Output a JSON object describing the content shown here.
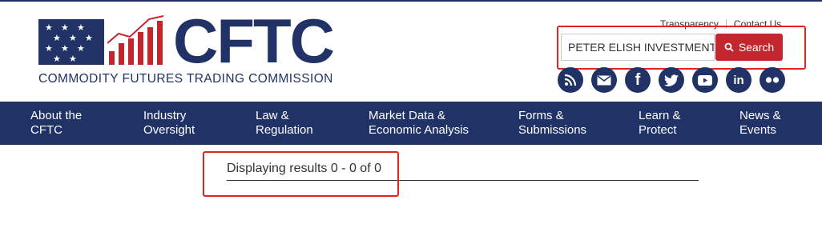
{
  "logo": {
    "wordmark": "CFTC",
    "subtitle": "COMMODITY FUTURES TRADING COMMISSION"
  },
  "top_links": [
    "Transparency",
    "Contact Us"
  ],
  "search": {
    "value": "PETER ELISH INVESTMENT",
    "button_label": "Search"
  },
  "social": [
    {
      "icon": "rss-icon",
      "glyph": "◥"
    },
    {
      "icon": "email-icon",
      "glyph": "✉"
    },
    {
      "icon": "facebook-icon",
      "glyph": "f"
    },
    {
      "icon": "twitter-icon",
      "glyph": "t"
    },
    {
      "icon": "youtube-icon",
      "glyph": "▶"
    },
    {
      "icon": "linkedin-icon",
      "glyph": "in"
    },
    {
      "icon": "flickr-icon",
      "glyph": "●●"
    }
  ],
  "nav": [
    {
      "line1": "About the",
      "line2": "CFTC"
    },
    {
      "line1": "Industry",
      "line2": "Oversight"
    },
    {
      "line1": "Law &",
      "line2": "Regulation"
    },
    {
      "line1": "Market Data &",
      "line2": "Economic Analysis"
    },
    {
      "line1": "Forms &",
      "line2": "Submissions"
    },
    {
      "line1": "Learn &",
      "line2": "Protect"
    },
    {
      "line1": "News &",
      "line2": "Events"
    }
  ],
  "results": {
    "text": "Displaying results 0 - 0 of 0"
  },
  "colors": {
    "navy": "#213266",
    "red": "#c4262e",
    "highlight": "#e0241f"
  }
}
